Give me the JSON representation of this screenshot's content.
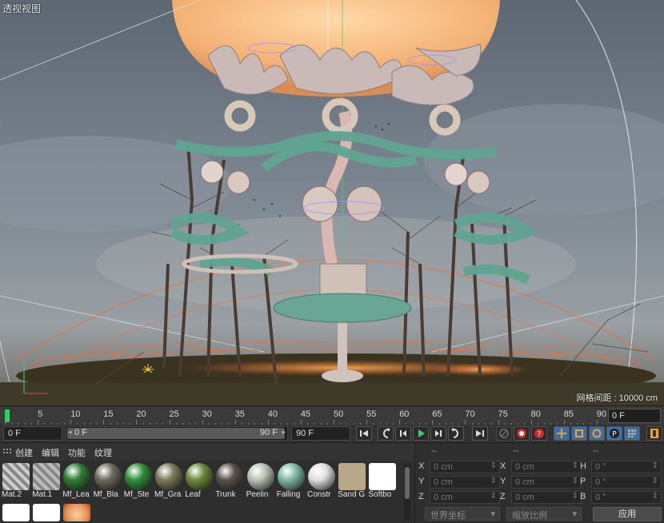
{
  "viewport": {
    "title": "透视视图",
    "grid_spacing": "网格间距 : 10000 cm"
  },
  "timeline": {
    "ticks": [
      "0",
      "5",
      "10",
      "15",
      "20",
      "25",
      "30",
      "35",
      "40",
      "45",
      "50",
      "55",
      "60",
      "65",
      "70",
      "75",
      "80",
      "85",
      "90"
    ],
    "end_frame": "0 F"
  },
  "transport": {
    "current_frame": "0 F",
    "range_start": "0 F",
    "range_end": "90 F",
    "max_frame": "90 F"
  },
  "materials": {
    "menu": [
      "创建",
      "编辑",
      "功能",
      "纹理"
    ],
    "items": [
      {
        "label": "Mat.2",
        "color": "#cfcfcf",
        "icon": "mat-gray"
      },
      {
        "label": "Mat.1",
        "color": "#bdbdbd",
        "icon": "mat-gray"
      },
      {
        "label": "Mf_Lea",
        "color": "#2e7d32",
        "icon": "sphere"
      },
      {
        "label": "Mf_Bla",
        "color": "#6e6a5a",
        "icon": "sphere"
      },
      {
        "label": "Mf_Ste",
        "color": "#2f8f3a",
        "icon": "sphere"
      },
      {
        "label": "Mf_Gra",
        "color": "#7d7a58",
        "icon": "sphere"
      },
      {
        "label": "Leaf",
        "color": "#6c8a3a",
        "icon": "sphere"
      },
      {
        "label": "Trunk",
        "color": "#5a5248",
        "icon": "sphere"
      },
      {
        "label": "Peelin",
        "color": "#b8c4b0",
        "icon": "sphere"
      },
      {
        "label": "Falling",
        "color": "#7fb8a4",
        "icon": "sphere"
      },
      {
        "label": "Constr",
        "color": "#e0e0e0",
        "icon": "sphere"
      },
      {
        "label": "Sand G",
        "color": "#b8a888",
        "icon": "square"
      },
      {
        "label": "Softbo",
        "color": "#ffffff",
        "icon": "square"
      }
    ],
    "row2": [
      {
        "color": "#ffffff"
      },
      {
        "color": "#ffffff"
      },
      {
        "color": "#e8925a"
      }
    ]
  },
  "coordinates": {
    "headers": [
      "--",
      "--",
      "--"
    ],
    "rows": [
      {
        "axis1": "X",
        "val1": "0 cm",
        "axis2": "X",
        "val2": "0 cm",
        "axis3": "H",
        "val3": "0 °"
      },
      {
        "axis1": "Y",
        "val1": "0 cm",
        "axis2": "Y",
        "val2": "0 cm",
        "axis3": "P",
        "val3": "0 °"
      },
      {
        "axis1": "Z",
        "val1": "0 cm",
        "axis2": "Z",
        "val2": "0 cm",
        "axis3": "B",
        "val3": "0 °"
      }
    ],
    "space_dropdown": "世界坐标",
    "scale_dropdown": "缩放比例",
    "apply": "应用"
  }
}
